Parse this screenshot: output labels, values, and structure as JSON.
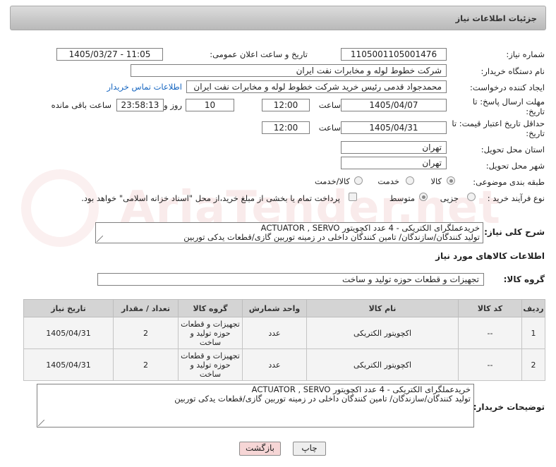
{
  "header": {
    "title": "جزئیات اطلاعات نیاز"
  },
  "fields": {
    "need_number_label": "شماره نیاز:",
    "need_number": "1105001105001476",
    "announce_label": "تاریخ و ساعت اعلان عمومی:",
    "announce_value": "1405/03/27 - 11:05",
    "buyer_org_label": "نام دستگاه خریدار:",
    "buyer_org": "شرکت خطوط لوله و مخابرات نفت ایران",
    "requester_label": "ایجاد کننده درخواست:",
    "requester": "محمدجواد قدمی رئیس خرید شرکت خطوط لوله و مخابرات نفت ایران",
    "contact_link": "اطلاعات تماس خریدار",
    "deadline_label": "مهلت ارسال پاسخ: تا تاریخ:",
    "deadline_date": "1405/04/07",
    "time_label": "ساعت",
    "deadline_time": "12:00",
    "days_value": "10",
    "days_label": "روز و",
    "remaining_time": "23:58:13",
    "remaining_label": "ساعت باقی مانده",
    "validity_label": "حداقل تاریخ اعتبار قیمت: تا تاریخ:",
    "validity_date": "1405/04/31",
    "validity_time": "12:00",
    "province_label": "استان محل تحویل:",
    "province": "تهران",
    "city_label": "شهر محل تحویل:",
    "city": "تهران",
    "category_label": "طبقه بندی موضوعی:",
    "category_options": [
      "کالا",
      "خدمت",
      "کالا/خدمت"
    ],
    "category_selected": "کالا",
    "process_label": "نوع فرآیند خرید :",
    "process_options": [
      "جزیی",
      "متوسط"
    ],
    "process_selected": "متوسط",
    "treasury_note": "پرداخت تمام یا بخشی از مبلغ خرید،از محل \"اسناد خزانه اسلامی\" خواهد بود.",
    "summary_label": "شرح کلی نیاز:",
    "summary_line1": "خریدعملگرای الکتریکی - 4 عدد اکچویتور  ACTUATOR , SERVO",
    "summary_line2": "تولید کنندگان/سازندگان/ تامین کنندگان داخلی در زمینه توربین گازی/قطعات یدکی توربین"
  },
  "goods": {
    "section_title": "اطلاعات کالاهای مورد نیاز",
    "group_label": "گروه کالا:",
    "group_value": "تجهیزات و قطعات حوزه تولید و ساخت",
    "columns": [
      "ردیف",
      "کد کالا",
      "نام کالا",
      "واحد شمارش",
      "گروه کالا",
      "تعداد / مقدار",
      "تاریخ نیاز"
    ],
    "rows": [
      {
        "index": "1",
        "code": "--",
        "name": "اکچویتور الکتریکی",
        "unit": "عدد",
        "group": "تجهیزات و قطعات حوزه تولید و ساخت",
        "qty": "2",
        "date": "1405/04/31"
      },
      {
        "index": "2",
        "code": "--",
        "name": "اکچویتور الکتریکی",
        "unit": "عدد",
        "group": "تجهیزات و قطعات حوزه تولید و ساخت",
        "qty": "2",
        "date": "1405/04/31"
      }
    ]
  },
  "buyer_notes": {
    "label": "توضیحات خریدار:",
    "line1": "خریدعملگرای الکتریکی - 4 عدد اکچویتور  ACTUATOR , SERVO",
    "line2": "تولید کنندگان/سازندگان/ تامین کنندگان داخلی در زمینه توربین گازی/قطعات یدکی توربین"
  },
  "buttons": {
    "print": "چاپ",
    "back": "بازگشت"
  },
  "watermark": "AriaTender.net",
  "colors": {
    "link": "#1565c0",
    "header_bg": "#c8c8c8",
    "back_button": "#f6d6d6"
  }
}
